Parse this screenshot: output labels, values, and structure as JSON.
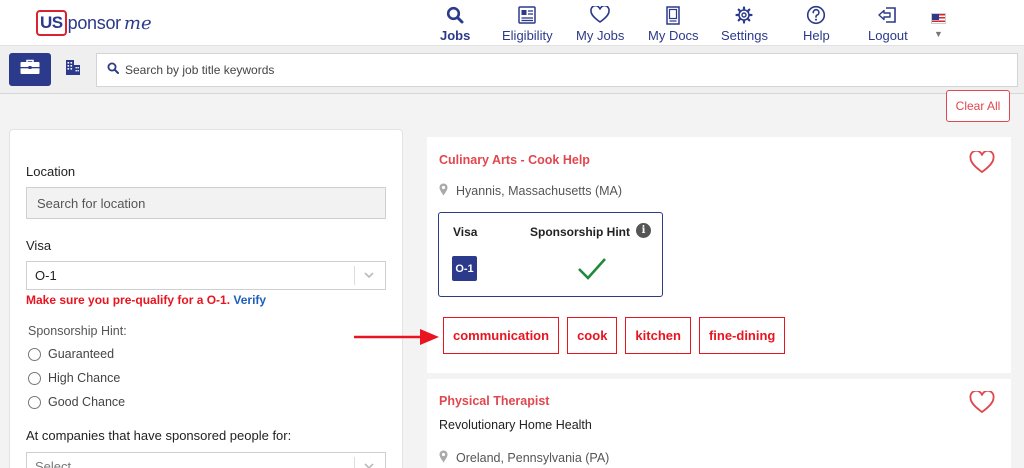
{
  "brand": {
    "part1": "US",
    "part2": "ponsor",
    "part3": "me"
  },
  "nav": {
    "jobs": "Jobs",
    "eligibility": "Eligibility",
    "my_jobs": "My Jobs",
    "my_docs": "My Docs",
    "settings": "Settings",
    "help": "Help",
    "logout": "Logout"
  },
  "search": {
    "placeholder": "Search by job title keywords"
  },
  "clear_all": "Clear All",
  "filters": {
    "location_label": "Location",
    "location_placeholder": "Search for location",
    "visa_label": "Visa",
    "visa_value": "O-1",
    "warning_text": "Make sure you pre-qualify for a O-1.",
    "warning_link": "Verify",
    "hint_label": "Sponsorship Hint:",
    "hint_options": [
      "Guaranteed",
      "High Chance",
      "Good Chance"
    ],
    "companies_label": "At companies that have sponsored people for:",
    "companies_placeholder": "Select..."
  },
  "jobs": [
    {
      "title": "Culinary Arts - Cook Help",
      "location": "Hyannis, Massachusetts (MA)",
      "visa_header": "Visa",
      "hint_header": "Sponsorship Hint",
      "visa_badge": "O-1",
      "tags": [
        "communication",
        "cook",
        "kitchen",
        "fine-dining"
      ]
    },
    {
      "title": "Physical Therapist",
      "company": "Revolutionary Home Health",
      "location": "Oreland, Pennsylvania (PA)"
    }
  ],
  "colors": {
    "brand_blue": "#2b3a8a",
    "accent_red": "#e0474f",
    "tag_red": "#e8141f"
  }
}
